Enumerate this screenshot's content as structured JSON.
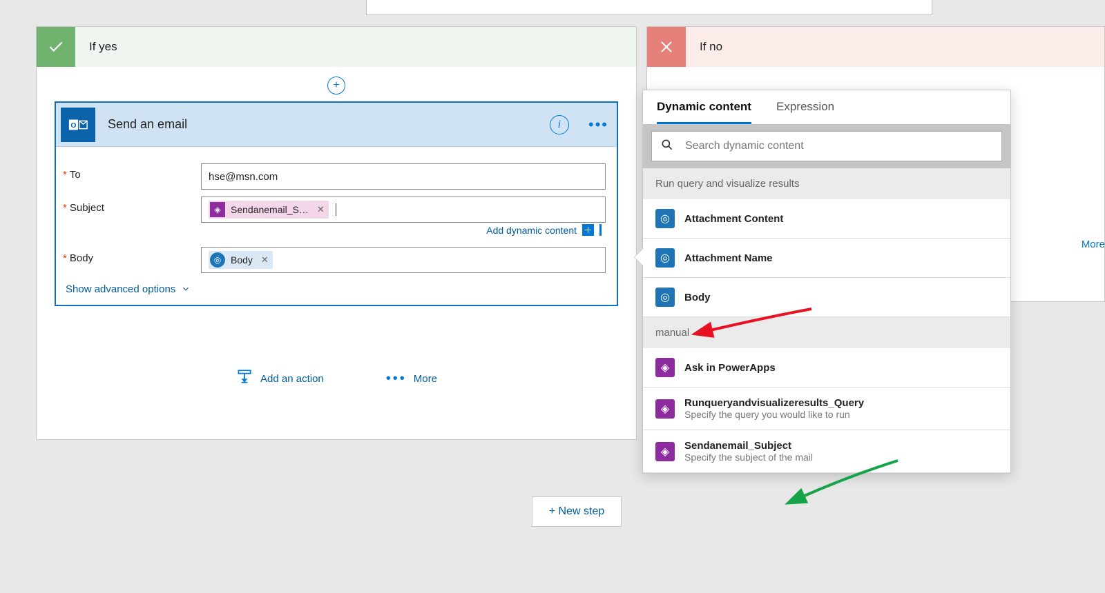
{
  "branches": {
    "yes_label": "If yes",
    "no_label": "If no"
  },
  "action": {
    "title": "Send an email",
    "fields": {
      "to_label": "To",
      "to_value": "hse@msn.com",
      "subject_label": "Subject",
      "subject_token": "Sendanemail_S…",
      "body_label": "Body",
      "body_token": "Body"
    },
    "add_dynamic": "Add dynamic content",
    "show_advanced": "Show advanced options",
    "footer_add_action": "Add an action",
    "footer_more": "More"
  },
  "newstep": "+ New step",
  "dc_panel": {
    "tabs": {
      "dynamic": "Dynamic content",
      "expression": "Expression"
    },
    "search_placeholder": "Search dynamic content",
    "sections": [
      {
        "title": "Run query and visualize results",
        "icon_color": "blue",
        "items": [
          {
            "title": "Attachment Content"
          },
          {
            "title": "Attachment Name"
          },
          {
            "title": "Body"
          }
        ]
      },
      {
        "title": "manual",
        "icon_color": "purple",
        "items": [
          {
            "title": "Ask in PowerApps"
          },
          {
            "title": "Runqueryandvisualizeresults_Query",
            "desc": "Specify the query you would like to run"
          },
          {
            "title": "Sendanemail_Subject",
            "desc": "Specify the subject of the mail"
          }
        ]
      }
    ]
  },
  "more_label": "More"
}
